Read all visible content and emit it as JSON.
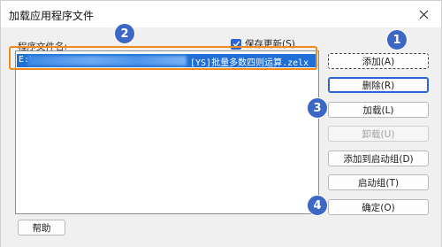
{
  "window": {
    "title": "加载应用程序文件"
  },
  "file_list": {
    "label": "程序文件名:",
    "items": [
      {
        "prefix": "E:\\",
        "filename": "[YS]批量多数四则运算.zelx"
      }
    ]
  },
  "save_history": {
    "label": "保存更新(S)",
    "checked": true
  },
  "buttons": {
    "add": "添加(A)",
    "delete": "删除(R)",
    "load": "加载(L)",
    "unload": "卸载(U)",
    "add_startup": "添加到启动组(D)",
    "startup_group": "启动组(T)",
    "ok": "确定(O)",
    "help": "帮助"
  },
  "badges": [
    "1",
    "2",
    "3",
    "4"
  ],
  "colors": {
    "selection": "#1f6fd6",
    "highlight_box": "#f08a1c",
    "badge": "#3c67c5"
  }
}
